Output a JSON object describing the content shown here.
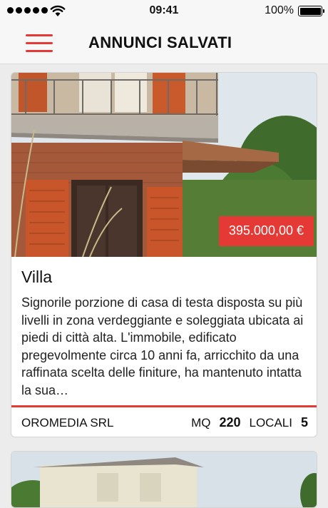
{
  "status_bar": {
    "time": "09:41",
    "battery": "100%"
  },
  "header": {
    "title": "ANNUNCI SALVATI",
    "menu_icon": "hamburger-icon",
    "accent_color": "#e53935"
  },
  "listings": [
    {
      "price": "395.000,00 €",
      "title": "Villa",
      "description": "Signorile porzione di casa di testa disposta su più livelli in zona verdeggiante e soleggiata ubicata ai piedi di città alta. L'immobile, edificato pregevolmente circa 10 anni fa, arricchito da una raffinata scelta delle finiture, ha mantenuto intatta la sua…",
      "agency": "OROMEDIA SRL",
      "mq_label": "MQ",
      "mq_value": "220",
      "locali_label": "LOCALI",
      "locali_value": "5"
    }
  ]
}
